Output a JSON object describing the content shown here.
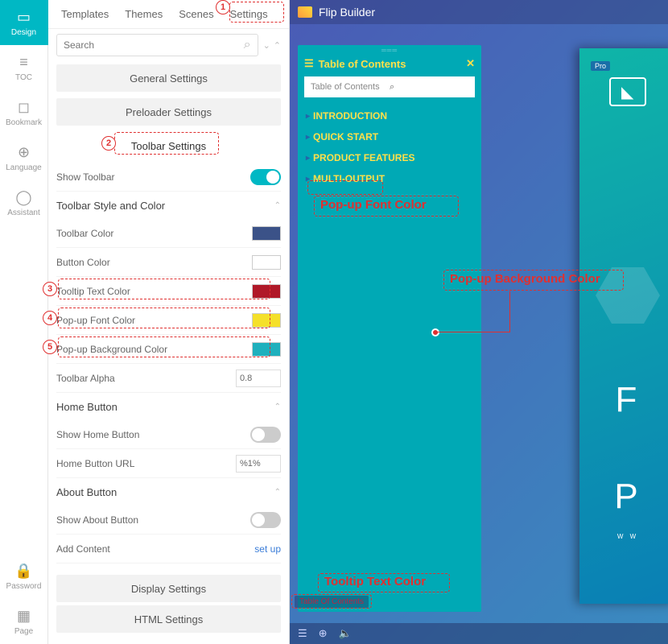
{
  "rail": {
    "items": [
      {
        "label": "Design",
        "active": true
      },
      {
        "label": "TOC"
      },
      {
        "label": "Bookmark"
      },
      {
        "label": "Language"
      },
      {
        "label": "Assistant"
      }
    ],
    "bottom": [
      {
        "label": "Password"
      },
      {
        "label": "Page"
      }
    ]
  },
  "tabs": [
    "Templates",
    "Themes",
    "Scenes",
    "Settings"
  ],
  "search_placeholder": "Search",
  "sections": {
    "general": "General Settings",
    "preloader": "Preloader Settings",
    "toolbar": "Toolbar Settings",
    "display": "Display Settings",
    "html": "HTML Settings"
  },
  "toolbar_settings": {
    "show_toolbar": "Show Toolbar",
    "style_head": "Toolbar Style and Color",
    "toolbar_color": {
      "label": "Toolbar Color",
      "value": "#3b5288"
    },
    "button_color": {
      "label": "Button Color",
      "value": "#ffffff"
    },
    "tooltip_text_color": {
      "label": "Tooltip Text Color",
      "value": "#b01828"
    },
    "popup_font_color": {
      "label": "Pop-up Font Color",
      "value": "#f5e02a"
    },
    "popup_bg_color": {
      "label": "Pop-up Background Color",
      "value": "#1fb0bd"
    },
    "toolbar_alpha": {
      "label": "Toolbar Alpha",
      "value": "0.8"
    },
    "home_head": "Home Button",
    "show_home": "Show Home Button",
    "home_url": {
      "label": "Home Button URL",
      "value": "%1%"
    },
    "about_head": "About Button",
    "show_about": "Show About Button",
    "add_content": {
      "label": "Add Content",
      "action": "set up"
    }
  },
  "preview": {
    "app_title": "Flip Builder",
    "toc_title": "Table of Contents",
    "toc_search": "Table of Contents",
    "toc_items": [
      "INTRODUCTION",
      "QUICK START",
      "PRODUCT FEATURES",
      "MULTI-OUTPUT"
    ],
    "cover": {
      "pro": "Pro",
      "line1": "F",
      "line2": "P",
      "small": "W W"
    },
    "tooltip_chip": "Table Of Contents"
  },
  "annotations": {
    "n1": "1",
    "n2": "2",
    "n3": "3",
    "n4": "4",
    "n5": "5",
    "popup_font": "Pop-up Font Color",
    "popup_bg": "Pop-up Background Color",
    "tooltip": "Tooltip Text Color"
  }
}
